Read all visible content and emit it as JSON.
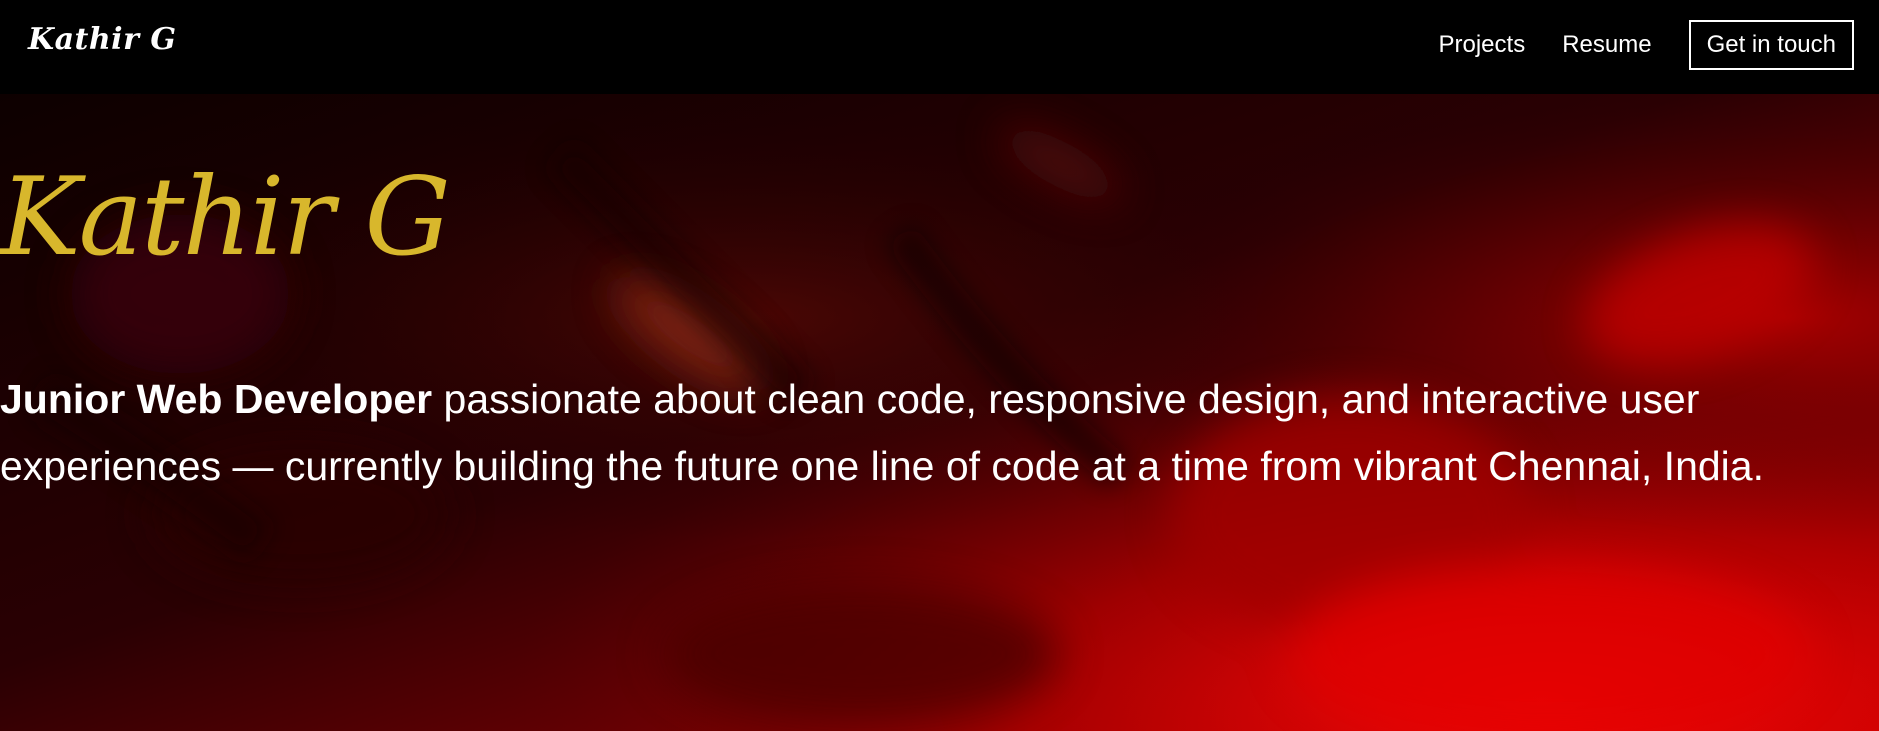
{
  "nav": {
    "brand": "Kathir G",
    "links": [
      {
        "label": "Projects"
      },
      {
        "label": "Resume"
      }
    ],
    "cta_label": "Get in touch"
  },
  "hero": {
    "title": "Kathir G",
    "role": "Junior Web Developer",
    "description": " passionate about clean code, responsive design, and interactive user experiences — currently building the future one line of code at a time from vibrant Chennai, India."
  },
  "colors": {
    "nav_background": "#000000",
    "title_accent": "#d8b72c",
    "hero_text": "#ffffff",
    "hero_bg_dark": "#1a0000",
    "hero_bg_bright": "#d80000"
  }
}
